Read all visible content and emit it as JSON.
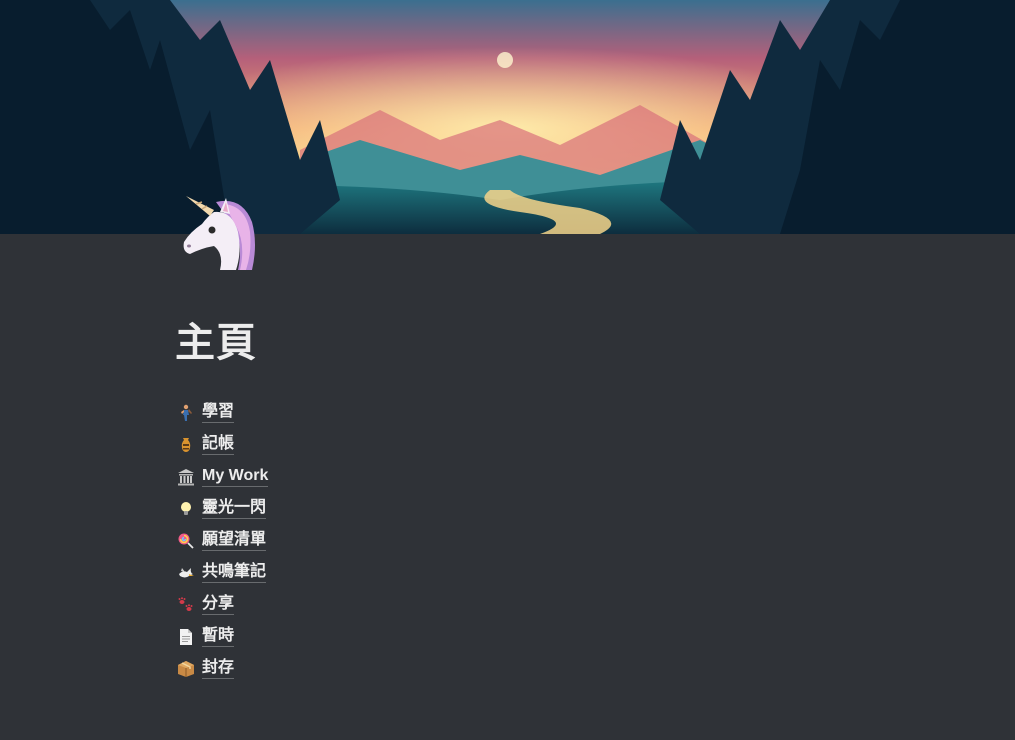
{
  "page": {
    "title": "主頁",
    "icon": "unicorn-icon",
    "cover": "forest-sunset-landscape",
    "background_color": "#2f3237"
  },
  "links": [
    {
      "icon": "hiker-icon",
      "label": "學習"
    },
    {
      "icon": "amphora-icon",
      "label": "記帳"
    },
    {
      "icon": "classical-building-icon",
      "label": "My Work"
    },
    {
      "icon": "light-bulb-icon",
      "label": "靈光一閃"
    },
    {
      "icon": "lollipop-icon",
      "label": "願望清單"
    },
    {
      "icon": "dove-icon",
      "label": "共鳴筆記"
    },
    {
      "icon": "paw-prints-icon",
      "label": "分享"
    },
    {
      "icon": "page-icon",
      "label": "暫時"
    },
    {
      "icon": "package-icon",
      "label": "封存"
    }
  ]
}
